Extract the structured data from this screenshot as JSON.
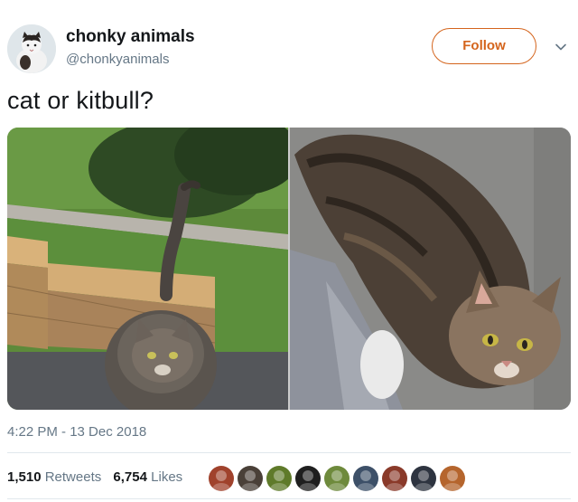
{
  "author": {
    "display_name": "chonky animals",
    "handle": "@chonkyanimals",
    "avatar_icon": "cat-avatar"
  },
  "follow_button": {
    "label": "Follow",
    "color": "#d4641c"
  },
  "menu_icon": "chevron-down-icon",
  "tweet": {
    "text": "cat or kitbull?",
    "timestamp": "4:22 PM - 13 Dec 2018"
  },
  "media": [
    {
      "name": "photo-cat-on-sidewalk"
    },
    {
      "name": "photo-cat-closeup"
    }
  ],
  "stats": {
    "retweets_count": "1,510",
    "retweets_label": "Retweets",
    "likes_count": "6,754",
    "likes_label": "Likes"
  },
  "liker_avatars": [
    {
      "icon": "liker-avatar-1",
      "color": "#a0422c"
    },
    {
      "icon": "liker-avatar-2",
      "color": "#4a4038"
    },
    {
      "icon": "liker-avatar-3",
      "color": "#5f7a2a"
    },
    {
      "icon": "liker-avatar-4",
      "color": "#1f1f1f"
    },
    {
      "icon": "liker-avatar-5",
      "color": "#6e8a3c"
    },
    {
      "icon": "liker-avatar-6",
      "color": "#3d5068"
    },
    {
      "icon": "liker-avatar-7",
      "color": "#8a3a2a"
    },
    {
      "icon": "liker-avatar-8",
      "color": "#2e3440"
    },
    {
      "icon": "liker-avatar-9",
      "color": "#b5652d"
    }
  ]
}
